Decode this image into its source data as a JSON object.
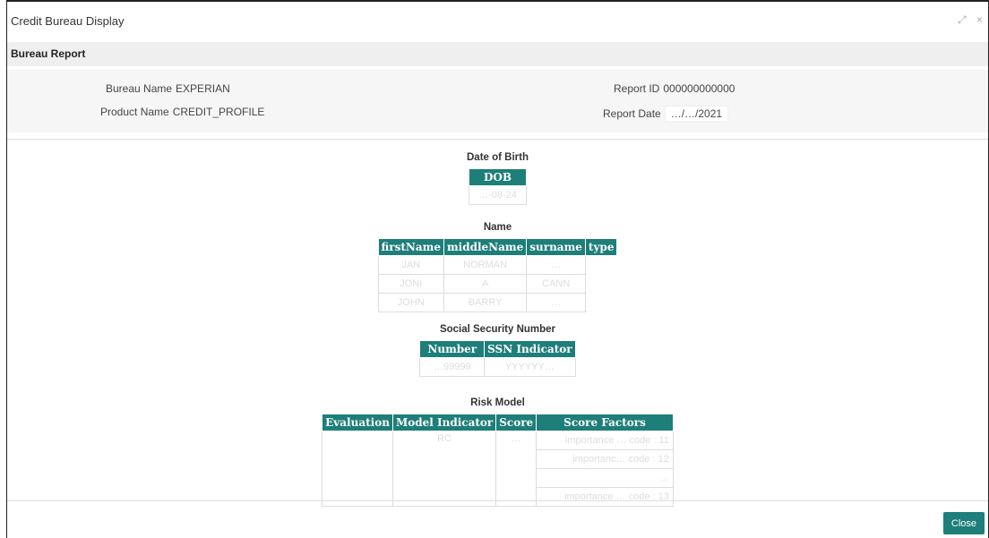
{
  "window": {
    "title": "Credit Bureau Display",
    "controls": [
      "⤢",
      "×"
    ]
  },
  "section": {
    "title": "Bureau Report"
  },
  "info": {
    "bureau_name_label": "Bureau Name",
    "bureau_name": "EXPERIAN",
    "product_name_label": "Product Name",
    "product_name": "CREDIT_PROFILE",
    "report_id_label": "Report ID",
    "report_id": "000000000000",
    "report_date_label": "Report Date",
    "report_date": "…/…/2021"
  },
  "dob": {
    "title": "Date of Birth",
    "header": "DOB",
    "value": "…-08-24"
  },
  "name": {
    "title": "Name",
    "headers": [
      "firstName",
      "middleName",
      "surname",
      "type"
    ],
    "rows": [
      [
        "JAN",
        "NORMAN",
        "…",
        ""
      ],
      [
        "JONI",
        "A",
        "CANN",
        ""
      ],
      [
        "JOHN",
        "BARRY",
        "…",
        ""
      ]
    ]
  },
  "ssn": {
    "title": "Social Security Number",
    "headers": [
      "Number",
      "SSN Indicator"
    ],
    "rows": [
      [
        "…99999",
        "YYYYYY…"
      ]
    ]
  },
  "risk": {
    "title": "Risk Model",
    "headers": [
      "Evaluation",
      "Model Indicator",
      "Score",
      "Score Factors"
    ],
    "rows": [
      [
        "",
        "RC",
        "…",
        "importance … code : 11"
      ],
      [
        "",
        "",
        "",
        "importanc… code : 12"
      ],
      [
        "",
        "",
        "",
        "…"
      ],
      [
        "",
        "",
        "",
        "importance … code : 13"
      ]
    ]
  },
  "footer": {
    "close_label": "Close"
  }
}
